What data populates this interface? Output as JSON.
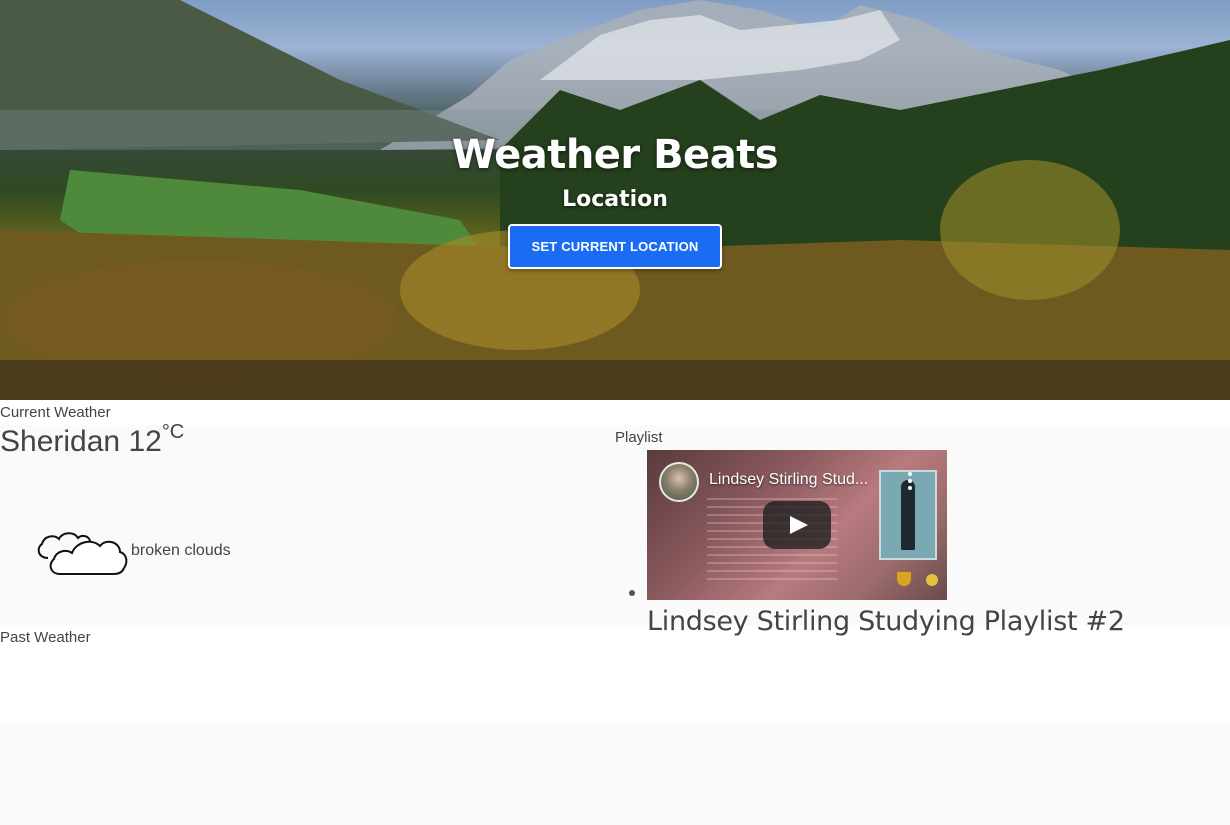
{
  "hero": {
    "title": "Weather Beats",
    "subtitle": "Location",
    "location_button": "SET CURRENT LOCATION"
  },
  "current_weather": {
    "label": "Current Weather",
    "city": "Sheridan",
    "temperature": "12",
    "unit": "°C",
    "condition": "broken clouds",
    "icon": "cloud-icon"
  },
  "past_weather": {
    "label": "Past Weather"
  },
  "playlist": {
    "label": "Playlist",
    "items": [
      {
        "video_title": "Lindsey Stirling Stud...",
        "title": "Lindsey Stirling Studying Playlist #2"
      }
    ]
  },
  "colors": {
    "accent": "#1a6cf3",
    "text": "#444444",
    "background": "#fafafa"
  }
}
